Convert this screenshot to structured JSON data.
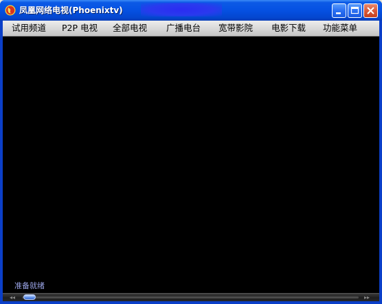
{
  "window": {
    "title": "凤凰网络电视(Phoenixtv)",
    "icon": "phoenix-logo-icon",
    "controls": [
      "minimize-icon",
      "maximize-icon",
      "close-icon"
    ]
  },
  "menu": {
    "items": [
      {
        "label": "试用频道"
      },
      {
        "label": "P2P 电视"
      },
      {
        "label": "全部电视"
      },
      {
        "label": "广播电台"
      },
      {
        "label": "宽带影院"
      },
      {
        "label": "电影下载"
      },
      {
        "label": "功能菜单"
      }
    ]
  },
  "status": {
    "text": "准备就绪"
  },
  "seekbar": {
    "position_fraction": 0.0,
    "left_arrow": "◂◂",
    "right_arrow": "▸▸"
  },
  "colors": {
    "titlebar": "#0551e2",
    "video_bg": "#000000",
    "status_text": "#9aa4e6"
  }
}
